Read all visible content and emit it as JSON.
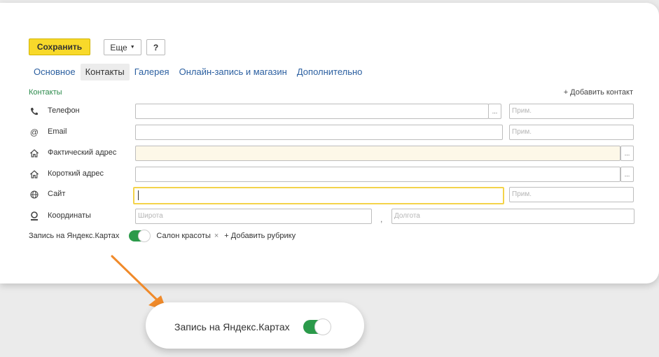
{
  "toolbar": {
    "save_label": "Сохранить",
    "more_label": "Еще",
    "help_label": "?"
  },
  "tabs": [
    {
      "label": "Основное",
      "active": false
    },
    {
      "label": "Контакты",
      "active": true
    },
    {
      "label": "Галерея",
      "active": false
    },
    {
      "label": "Онлайн-запись и магазин",
      "active": false
    },
    {
      "label": "Дополнительно",
      "active": false
    }
  ],
  "contacts": {
    "section_title": "Контакты",
    "add_contact": "+ Добавить контакт",
    "phone": {
      "label": "Телефон",
      "value": "",
      "note_placeholder": "Прим.",
      "icon": "phone-icon"
    },
    "email": {
      "label": "Email",
      "value": "",
      "note_placeholder": "Прим.",
      "icon": "at-icon"
    },
    "actual_address": {
      "label": "Фактический адрес",
      "value": "",
      "icon": "house-icon"
    },
    "short_address": {
      "label": "Короткий адрес",
      "value": "",
      "icon": "house-icon"
    },
    "site": {
      "label": "Сайт",
      "value": "",
      "note_placeholder": "Прим.",
      "icon": "globe-icon"
    },
    "coordinates": {
      "label": "Координаты",
      "lat_placeholder": "Широта",
      "lon_placeholder": "Долгота",
      "separator": ",",
      "icon": "pin-icon"
    }
  },
  "yandex": {
    "label": "Запись на Яндекс.Картах",
    "enabled": true,
    "rubric": "Салон красоты",
    "rubric_remove": "×",
    "add_rubric": "+ Добавить рубрику"
  },
  "zoom_callout": {
    "label": "Запись на Яндекс.Картах",
    "enabled": true
  },
  "colors": {
    "save_button": "#f8d92a",
    "toggle_on": "#2b9a4a",
    "tab_link": "#2b5fa0",
    "section_title": "#2b8a4b",
    "arrow": "#f08a2a"
  }
}
